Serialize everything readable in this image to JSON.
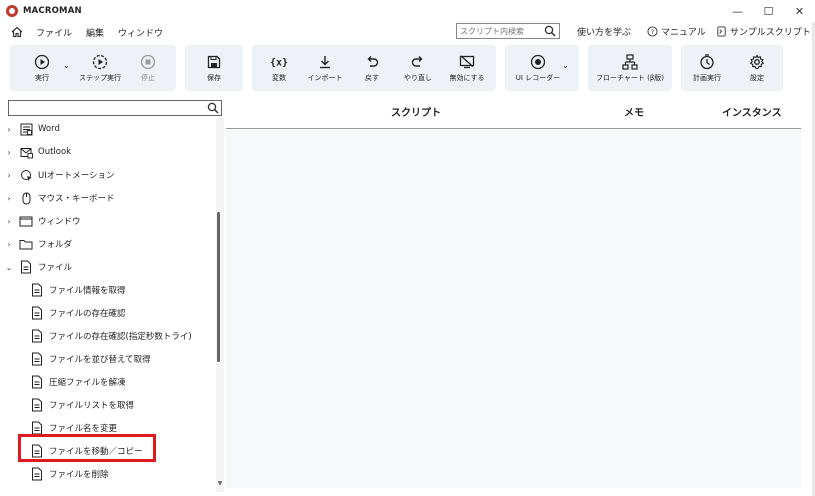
{
  "window": {
    "title": "MACROMAN",
    "controls": [
      "—",
      "☐",
      "✕"
    ]
  },
  "menubar": {
    "items": [
      "ファイル",
      "編集",
      "ウィンドウ"
    ],
    "search_placeholder": "スクリプト内検索",
    "links": [
      "使い方を学ぶ",
      "マニュアル",
      "サンプルスクリプト"
    ]
  },
  "toolbar": {
    "run": "実行",
    "step_run": "ステップ実行",
    "stop": "停止",
    "save": "保存",
    "variables": "変数",
    "import": "インポート",
    "undo": "戻す",
    "redo": "やり直し",
    "disable": "無効にする",
    "ui_recorder": "UI レコーダー",
    "flowchart": "フローチャート (β版)",
    "schedule": "計画実行",
    "settings": "設定"
  },
  "sidebar": {
    "search_placeholder": "",
    "categories": [
      {
        "label": "Word",
        "icon": "word-doc-icon",
        "expanded": false
      },
      {
        "label": "Outlook",
        "icon": "mail-icon",
        "expanded": false
      },
      {
        "label": "UIオートメーション",
        "icon": "cursor-click-icon",
        "expanded": false
      },
      {
        "label": "マウス・キーボード",
        "icon": "mouse-icon",
        "expanded": false
      },
      {
        "label": "ウィンドウ",
        "icon": "window-icon",
        "expanded": false
      },
      {
        "label": "フォルダ",
        "icon": "folder-icon",
        "expanded": false
      },
      {
        "label": "ファイル",
        "icon": "file-icon",
        "expanded": true
      }
    ],
    "file_items": [
      "ファイル情報を取得",
      "ファイルの存在確認",
      "ファイルの存在確認(指定秒数トライ)",
      "ファイルを並び替えて取得",
      "圧縮ファイルを解凍",
      "ファイルリストを取得",
      "ファイル名を変更",
      "ファイルを移動／コピー",
      "ファイルを削除"
    ],
    "highlighted_item": "ファイルを移動／コピー"
  },
  "main": {
    "columns": [
      "スクリプト",
      "メモ",
      "インスタンス"
    ]
  }
}
